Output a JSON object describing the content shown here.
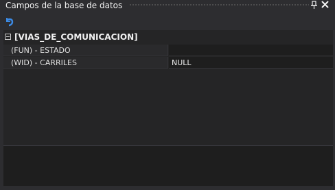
{
  "window": {
    "title": "Campos de la base de datos",
    "pin_icon": "pin-icon",
    "close_icon": "close-icon"
  },
  "toolbar": {
    "undo_icon": "undo-icon"
  },
  "grid": {
    "category": "[VIAS_DE_COMUNICACION]",
    "properties": [
      {
        "name": "(FUN) - ESTADO",
        "value": ""
      },
      {
        "name": "(WID) - CARRILES",
        "value": "NULL"
      }
    ]
  },
  "colors": {
    "background": "#2d2d30",
    "grid_background": "#252526",
    "text": "#f1f1f1",
    "icon_accent": "#3c8be5"
  }
}
